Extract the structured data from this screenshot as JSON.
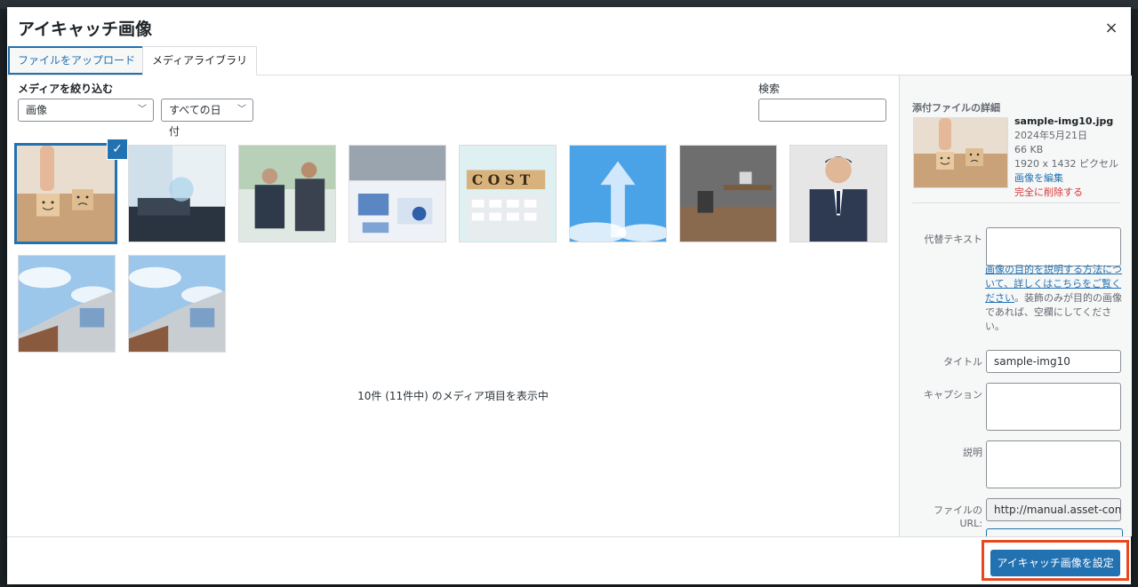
{
  "modal": {
    "title": "アイキャッチ画像",
    "close_icon": "×"
  },
  "tabs": [
    {
      "label": "ファイルをアップロード"
    },
    {
      "label": "メディアライブラリ"
    }
  ],
  "filters": {
    "label": "メディアを絞り込む",
    "type_value": "画像",
    "date_value": "すべての日付",
    "chevron": "⌵"
  },
  "search": {
    "label": "検索",
    "placeholder": ""
  },
  "media_items": [
    {
      "id": "img10",
      "desc": "wooden blocks smile",
      "selected": true
    },
    {
      "id": "laptop",
      "desc": "laptop data"
    },
    {
      "id": "meeting",
      "desc": "business meeting"
    },
    {
      "id": "charts",
      "desc": "charts papers"
    },
    {
      "id": "cost",
      "desc": "COST blocks calculator"
    },
    {
      "id": "arrow",
      "desc": "cloud arrow sky"
    },
    {
      "id": "office",
      "desc": "office room"
    },
    {
      "id": "businessman",
      "desc": "businessman portrait"
    },
    {
      "id": "building1",
      "desc": "building sky"
    },
    {
      "id": "building2",
      "desc": "building sky"
    }
  ],
  "check_icon": "✓",
  "count_text": "10件 (11件中) のメディア項目を表示中",
  "details": {
    "heading": "添付ファイルの詳細",
    "filename": "sample-img10.jpg",
    "date": "2024年5月21日",
    "size": "66 KB",
    "dimensions": "1920 x 1432 ピクセル",
    "edit_link": "画像を編集",
    "delete_link": "完全に削除する",
    "alt_label": "代替テキスト",
    "alt_value": "",
    "alt_help_link": "画像の目的を説明する方法について、詳しくはこちらをご覧ください",
    "alt_help_text": "。装飾のみが目的の画像であれば、空欄にしてください。",
    "title_label": "タイトル",
    "title_value": "sample-img10",
    "caption_label": "キャプション",
    "caption_value": "",
    "description_label": "説明",
    "description_value": "",
    "url_label": "ファイルのURL:",
    "url_value": "http://manual.asset-conve"
  },
  "toolbar": {
    "set_button": "アイキャッチ画像を設定"
  },
  "colors": {
    "accent": "#2271b1",
    "delete": "#d63638",
    "highlight": "#e8481e"
  }
}
